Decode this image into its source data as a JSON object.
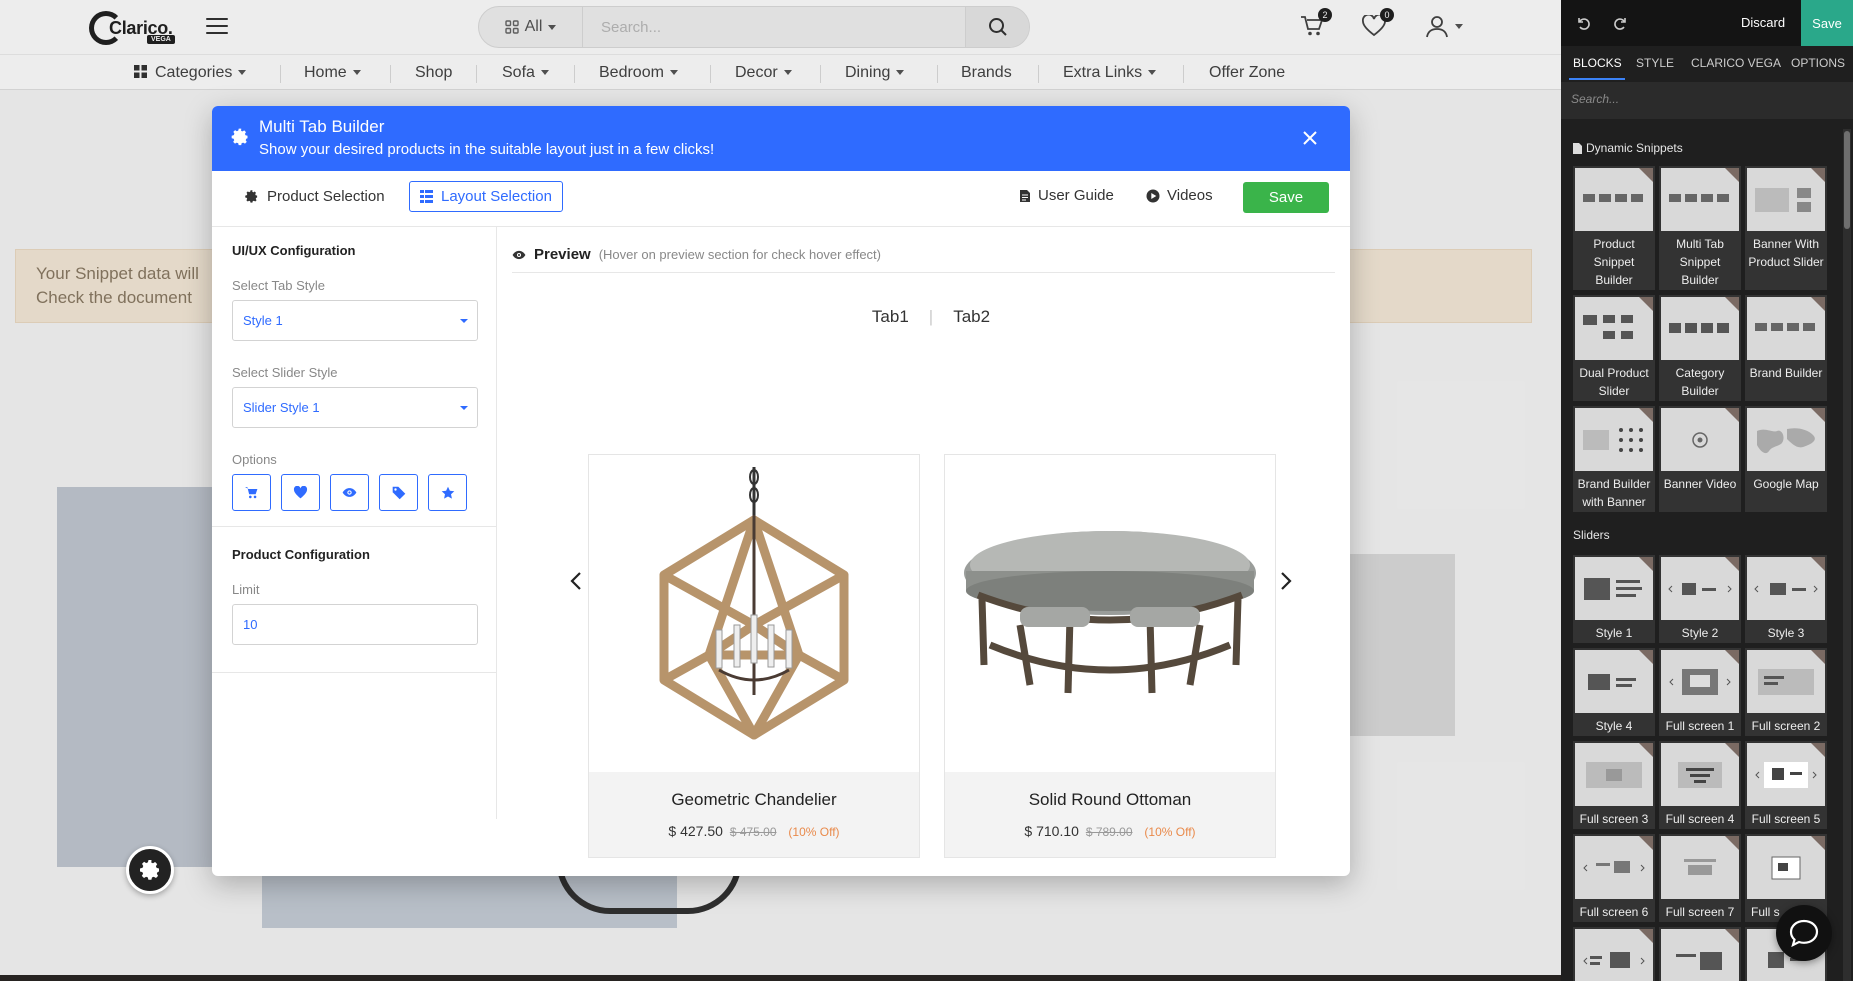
{
  "site": {
    "logo_text": "Clarico.",
    "logo_badge": "VEGA",
    "search": {
      "category": "All",
      "placeholder": "Search..."
    },
    "cart_count": "2",
    "wishlist_count": "0",
    "nav": [
      "Categories",
      "Home",
      "Shop",
      "Sofa",
      "Bedroom",
      "Decor",
      "Dining",
      "Brands",
      "Extra Links",
      "Offer Zone"
    ],
    "notice_line1": "Your Snippet data will",
    "notice_line2": "Check the document"
  },
  "modal": {
    "title": "Multi Tab Builder",
    "subtitle": "Show your desired products in the suitable layout just in a few clicks!",
    "tabs": {
      "product_selection": "Product Selection",
      "layout_selection": "Layout Selection"
    },
    "links": {
      "user_guide": "User Guide",
      "videos": "Videos"
    },
    "save_label": "Save",
    "uiux": {
      "title": "UI/UX Configuration",
      "tab_style_label": "Select Tab Style",
      "tab_style_value": "Style 1",
      "slider_style_label": "Select Slider Style",
      "slider_style_value": "Slider Style 1",
      "options_label": "Options"
    },
    "product_config": {
      "title": "Product Configuration",
      "limit_label": "Limit",
      "limit_value": "10"
    },
    "preview": {
      "title": "Preview",
      "hint": "(Hover on preview section for check hover effect)",
      "tab1": "Tab1",
      "tab2": "Tab2",
      "products": [
        {
          "name": "Geometric Chandelier",
          "price": "$ 427.50",
          "old_price": "$ 475.00",
          "discount": "(10% Off)"
        },
        {
          "name": "Solid Round Ottoman",
          "price": "$ 710.10",
          "old_price": "$ 789.00",
          "discount": "(10% Off)"
        }
      ]
    }
  },
  "editor": {
    "discard": "Discard",
    "save": "Save",
    "tabs": [
      "BLOCKS",
      "STYLE",
      "CLARICO VEGA",
      "OPTIONS"
    ],
    "search_placeholder": "Search...",
    "sections": {
      "dynamic": "Dynamic Snippets",
      "sliders": "Sliders"
    },
    "dynamic_tiles": [
      "Product Snippet Builder",
      "Multi Tab Snippet Builder",
      "Banner With Product Slider",
      "Dual Product Slider",
      "Category Builder",
      "Brand Builder",
      "Brand Builder with Banner",
      "Banner Video",
      "Google Map"
    ],
    "slider_tiles": [
      "Style 1",
      "Style 2",
      "Style 3",
      "Style 4",
      "Full screen 1",
      "Full screen 2",
      "Full screen 3",
      "Full screen 4",
      "Full screen 5",
      "Full screen 6",
      "Full screen 7",
      "Full s"
    ]
  },
  "colors": {
    "primary": "#2f6bff",
    "save_green": "#3ab44a",
    "panel_bg": "#1f1f1f",
    "panel_save": "#2aa88a"
  }
}
